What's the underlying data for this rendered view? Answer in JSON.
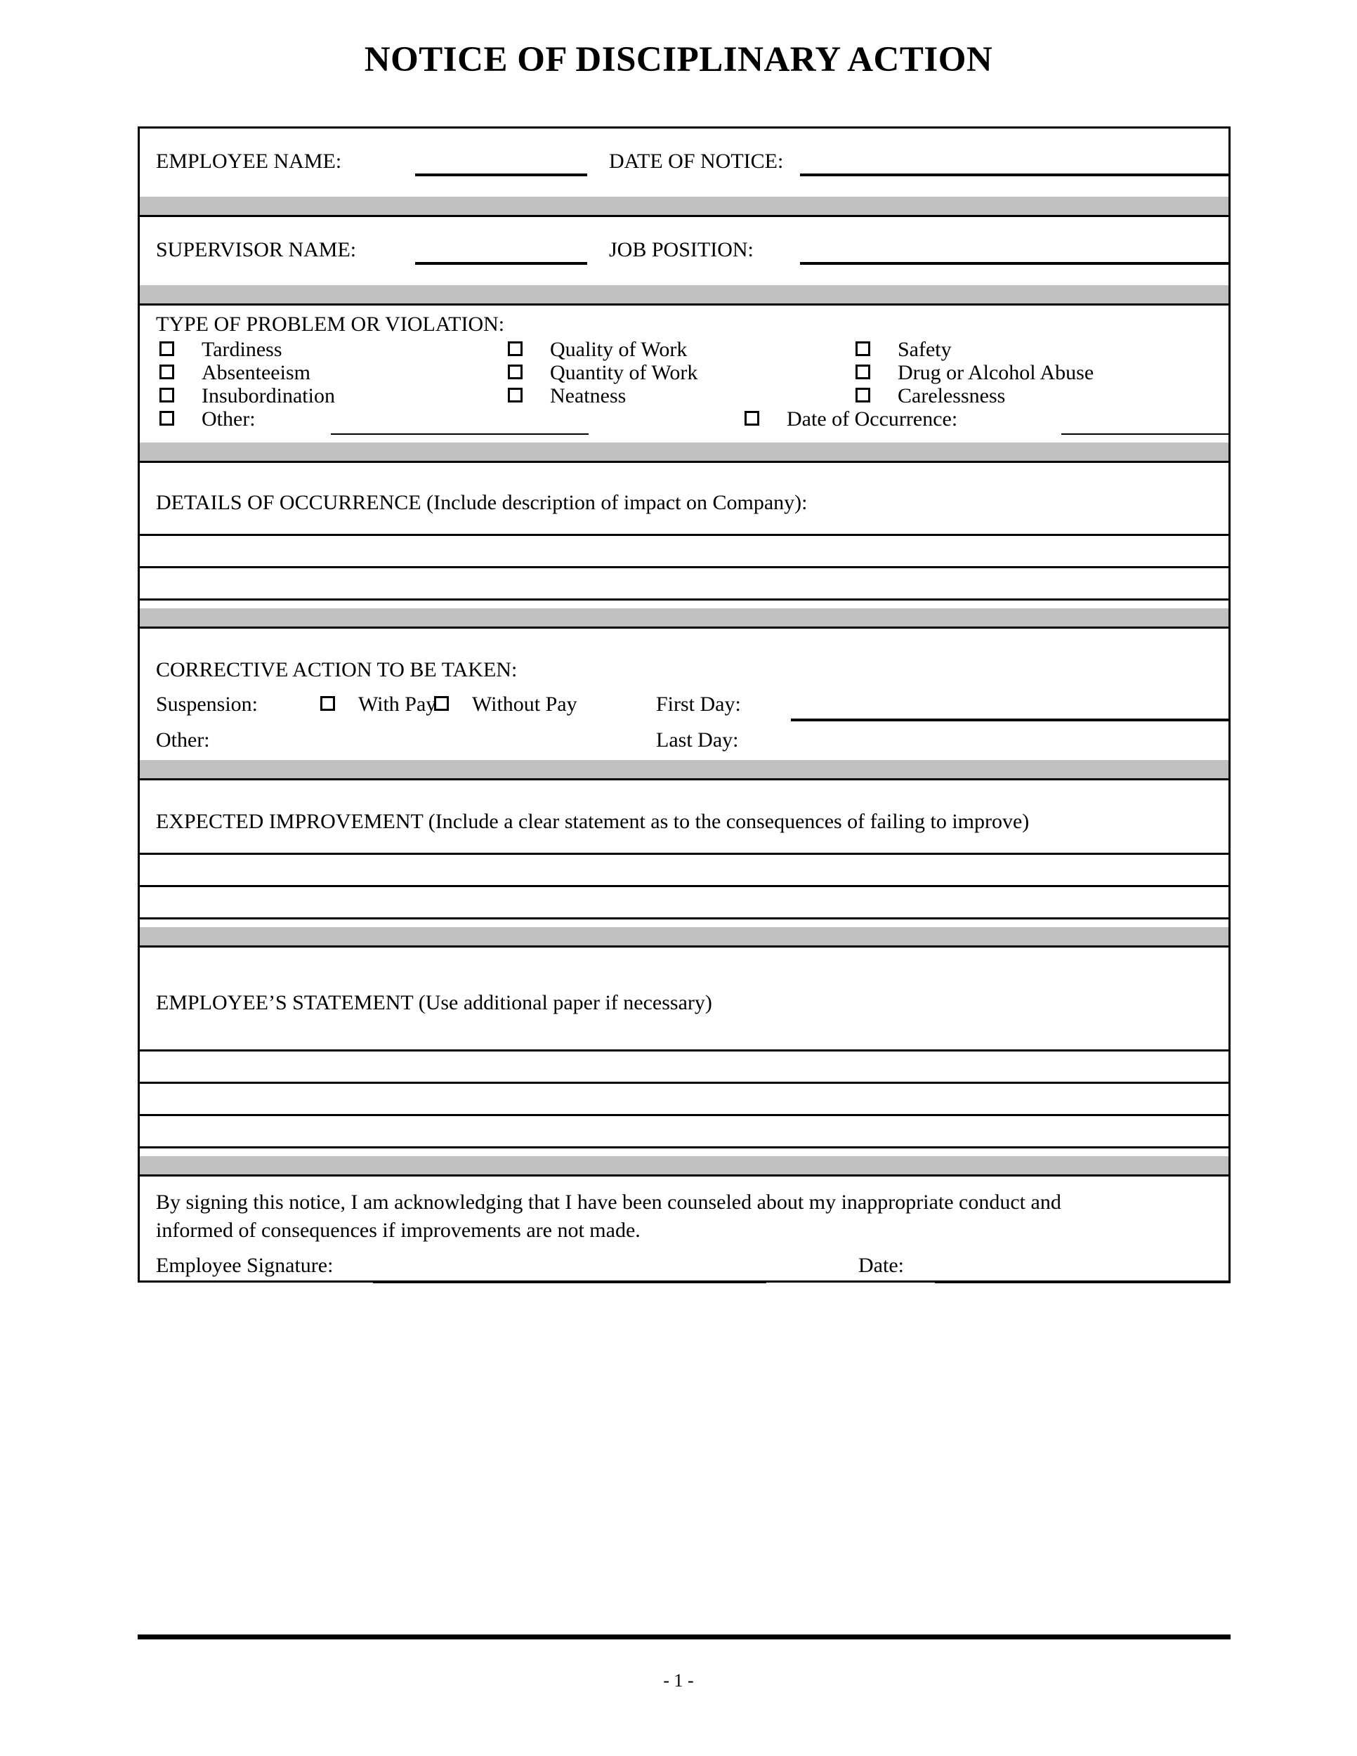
{
  "document": {
    "title": "NOTICE OF DISCIPLINARY ACTION",
    "page_number": "- 1 -",
    "colors": {
      "divider_band": "#c0c0c0",
      "rule": "#000000",
      "paper": "#ffffff"
    }
  },
  "identification": {
    "employee_name_label": "EMPLOYEE NAME:",
    "date_of_notice_label": "DATE OF NOTICE:",
    "employee_name_value": "",
    "date_of_notice_value": "",
    "supervisor_name_label": "SUPERVISOR NAME:",
    "job_position_label": "JOB POSITION:",
    "supervisor_name_value": "",
    "job_position_value": ""
  },
  "violation": {
    "heading": "TYPE OF PROBLEM OR VIOLATION:",
    "columns": [
      [
        "Tardiness",
        "Absenteeism",
        "Insubordination"
      ],
      [
        "Quality of Work",
        "Quantity of Work",
        "Neatness"
      ],
      [
        "Safety",
        "Drug or Alcohol Abuse",
        "Carelessness"
      ]
    ],
    "other_label": "Other:",
    "other_value": "",
    "date_of_occurrence_label": "Date of Occurrence:",
    "date_of_occurrence_value": ""
  },
  "details": {
    "heading": "DETAILS OF OCCURRENCE (Include description of impact on Company):",
    "lines": [
      "",
      "",
      ""
    ]
  },
  "corrective_action": {
    "heading": "CORRECTIVE ACTION TO BE TAKEN:",
    "suspension_label": "Suspension:",
    "with_pay_label": "With Pay",
    "without_pay_label": "Without Pay",
    "other_label": "Other:",
    "other_value": "",
    "first_day_label": "First Day:",
    "first_day_value": "",
    "last_day_label": "Last Day:",
    "last_day_value": ""
  },
  "expected_improvement": {
    "heading": "EXPECTED IMPROVEMENT (Include a clear statement as to the consequences of failing to improve)",
    "lines": [
      "",
      "",
      ""
    ]
  },
  "employee_statement": {
    "heading": "EMPLOYEE’S STATEMENT (Use additional paper if necessary)",
    "lines": [
      "",
      "",
      "",
      ""
    ]
  },
  "acknowledgement": {
    "paragraph_line_1": "By signing this notice, I am acknowledging that I have been counseled about my inappropriate conduct and",
    "paragraph_line_2": "informed of consequences if improvements are not made.",
    "signature_label": "Employee Signature:",
    "signature_value": "",
    "date_label": "Date:",
    "date_value": ""
  }
}
